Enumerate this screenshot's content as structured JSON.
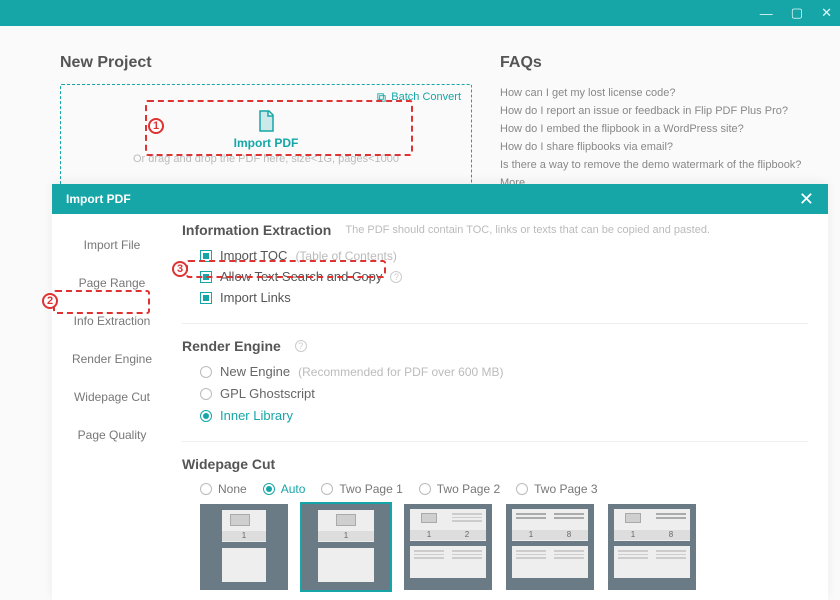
{
  "titlebar": {
    "min": "—",
    "max": "▢",
    "close": "✕"
  },
  "newProject": {
    "title": "New Project",
    "batch": "Batch Convert",
    "dropTitle": "Import PDF",
    "dropSub": "Or drag and drop the PDF here, size<1G, pages<1000"
  },
  "faqs": {
    "title": "FAQs",
    "items": [
      "How can I get my lost license code?",
      "How do I report an issue or feedback in Flip PDF Plus Pro?",
      "How do I embed the flipbook in a WordPress site?",
      "How do I share flipbooks via email?",
      "Is there a way to remove the demo watermark of the flipbook?",
      "More..."
    ]
  },
  "modal": {
    "title": "Import PDF",
    "close": "✕"
  },
  "sidebar": {
    "items": [
      {
        "label": "Import File"
      },
      {
        "label": "Page Range"
      },
      {
        "label": "Info Extraction"
      },
      {
        "label": "Render Engine"
      },
      {
        "label": "Widepage Cut"
      },
      {
        "label": "Page Quality"
      }
    ]
  },
  "info": {
    "title": "Information Extraction",
    "hint": "The PDF should contain TOC, links or texts that can be copied and pasted.",
    "items": [
      {
        "label": "Import TOC",
        "sub": "(Table of Contents)"
      },
      {
        "label": "Allow Text Search and Copy"
      },
      {
        "label": "Import Links"
      }
    ]
  },
  "render": {
    "title": "Render Engine",
    "options": [
      {
        "label": "New Engine",
        "sub": "(Recommended for PDF over 600 MB)"
      },
      {
        "label": "GPL Ghostscript"
      },
      {
        "label": "Inner Library"
      }
    ]
  },
  "wide": {
    "title": "Widepage Cut",
    "options": [
      "None",
      "Auto",
      "Two Page 1",
      "Two Page 2",
      "Two Page 3"
    ]
  }
}
